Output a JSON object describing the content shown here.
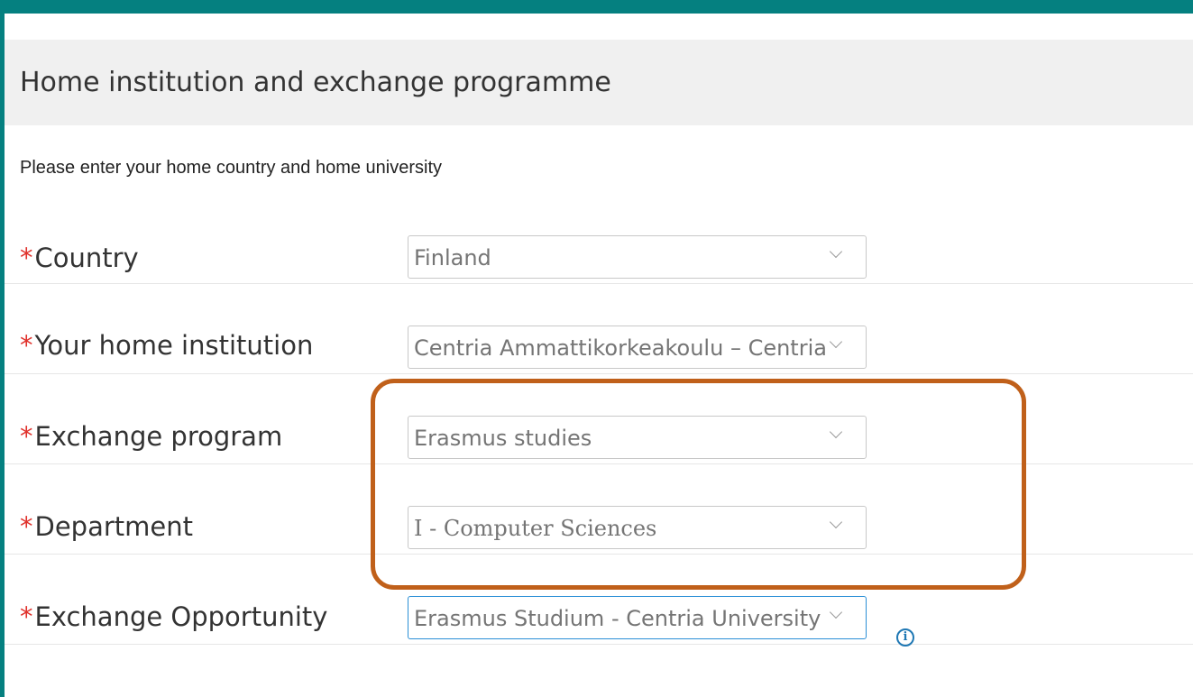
{
  "section": {
    "title": "Home institution and exchange programme",
    "intro": "Please enter your home country and home university"
  },
  "form": {
    "required_marker": "*",
    "fields": [
      {
        "label": "Country",
        "value": "Finland"
      },
      {
        "label": "Your home institution",
        "value": "Centria Ammattikorkeakoulu – Centria"
      },
      {
        "label": "Exchange program",
        "value": "Erasmus studies"
      },
      {
        "label": "Department",
        "value": "I - Computer Sciences"
      },
      {
        "label": "Exchange Opportunity",
        "value": "Erasmus Studium - Centria University"
      }
    ]
  },
  "info_icon": {
    "glyph": "i"
  },
  "colors": {
    "frame": "#058080",
    "required": "#e0312b",
    "highlight": "#c0601a",
    "focus": "#2b8fd6"
  },
  "icons": {
    "dropdown": "chevron-down-icon",
    "info": "info-icon"
  }
}
